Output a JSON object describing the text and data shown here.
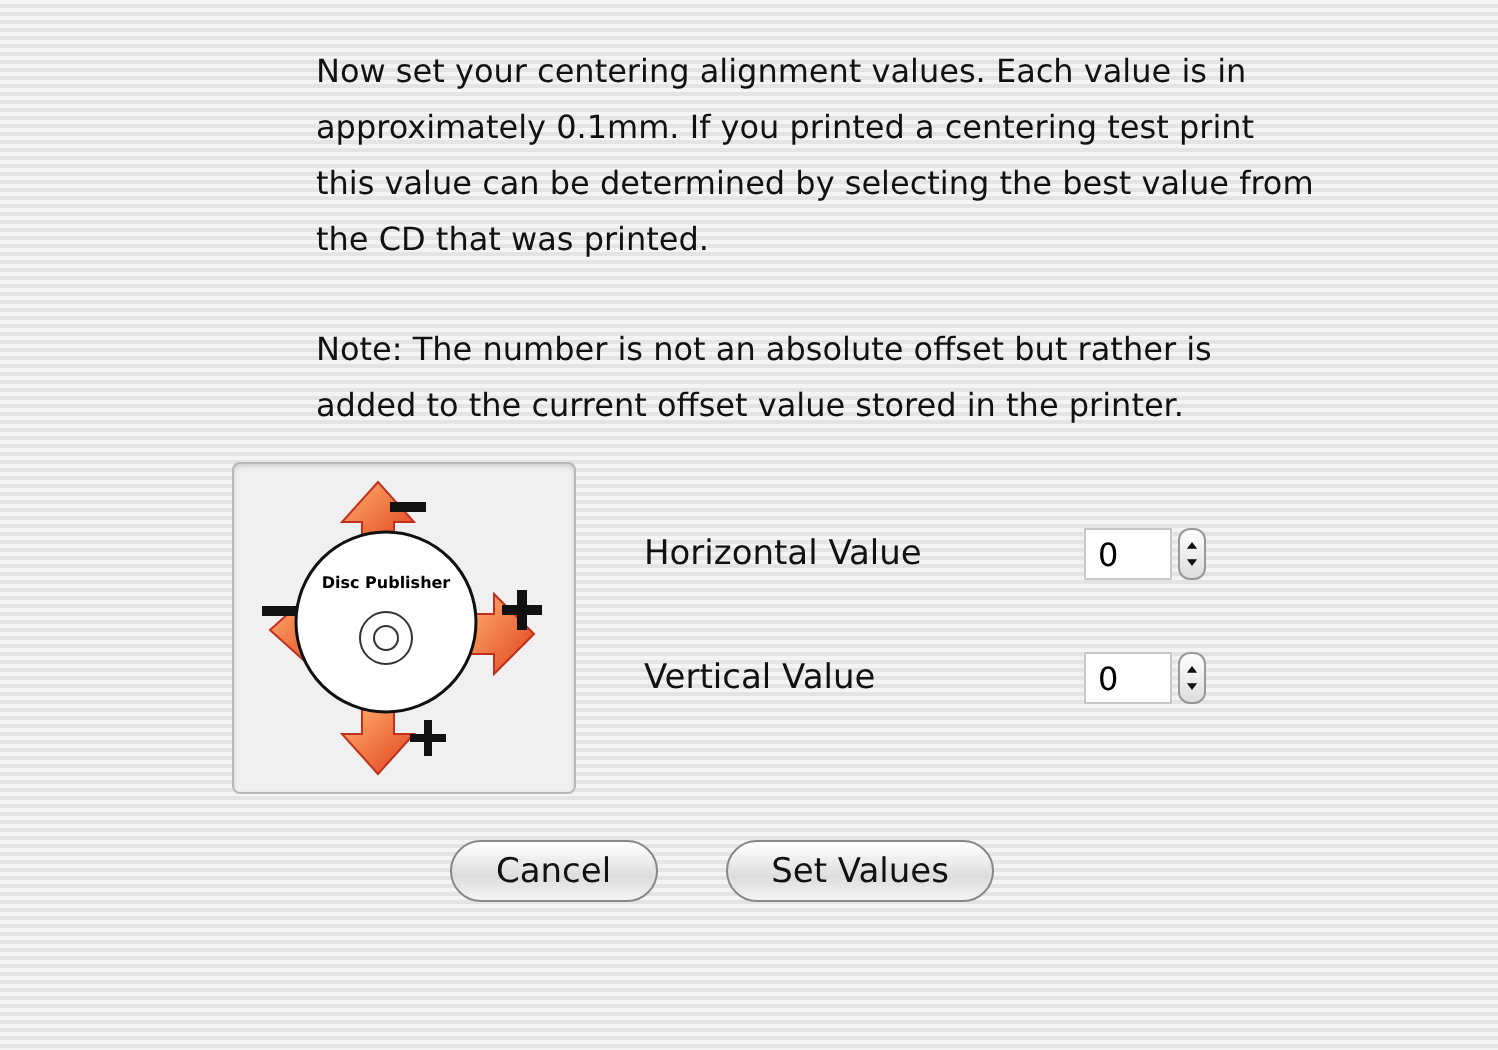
{
  "sheet": {
    "paragraphs": [
      "Now set your centering alignment values.  Each value is in approximately 0.1mm.  If you printed a centering test print this value can be determined by selecting the best value from the CD that was printed.",
      "Note:  The number is not an absolute offset but rather is added to the current offset value stored in the printer."
    ],
    "diagram": {
      "disc_label": "Disc Publisher"
    },
    "fields": [
      {
        "label": "Horizontal Value",
        "value": "0"
      },
      {
        "label": "Vertical Value",
        "value": "0"
      }
    ],
    "buttons": [
      {
        "label": "Cancel",
        "default": false
      },
      {
        "label": "Set Values",
        "default": false
      }
    ]
  }
}
